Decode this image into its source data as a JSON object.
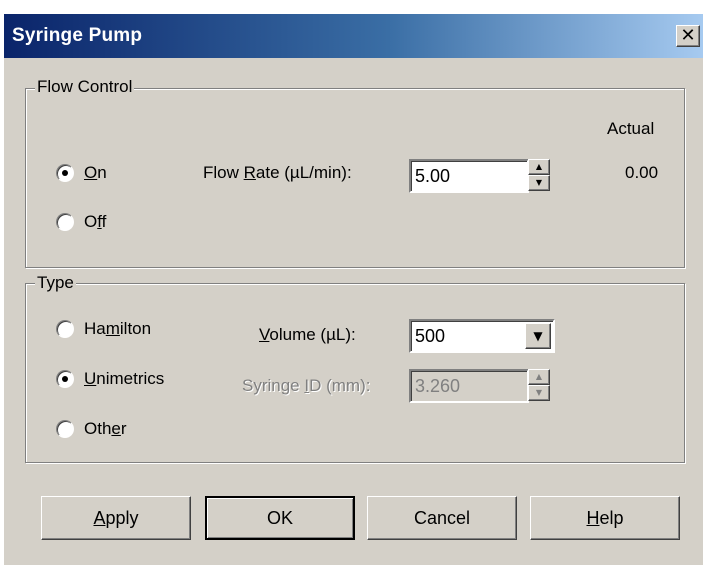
{
  "window": {
    "title": "Syringe Pump",
    "close_glyph": "✕"
  },
  "flow_control": {
    "legend": "Flow Control",
    "actual_header": "Actual",
    "on": {
      "mnemonic": "O",
      "rest": "n",
      "selected": true
    },
    "off": {
      "pre": "O",
      "mnemonic": "f",
      "rest": "f",
      "selected": false
    },
    "flow_rate_label": {
      "pre": "Flow ",
      "mnemonic": "R",
      "rest": "ate (µL/min):"
    },
    "flow_rate_value": "5.00",
    "actual_value": "0.00"
  },
  "type": {
    "legend": "Type",
    "hamilton": {
      "pre": "Ha",
      "mnemonic": "m",
      "rest": "ilton",
      "selected": false
    },
    "unimetrics": {
      "mnemonic": "U",
      "rest": "nimetrics",
      "selected": true
    },
    "other": {
      "pre": "Oth",
      "mnemonic": "e",
      "rest": "r",
      "selected": false
    },
    "volume_label": {
      "mnemonic": "V",
      "rest": "olume (µL):"
    },
    "volume_value": "500",
    "syringe_id_label": {
      "pre": "Syringe ",
      "mnemonic": "I",
      "rest": "D (mm):"
    },
    "syringe_id_value": "3.260"
  },
  "buttons": {
    "apply": {
      "mnemonic": "A",
      "rest": "pply"
    },
    "ok": "OK",
    "cancel": "Cancel",
    "help": {
      "mnemonic": "H",
      "rest": "elp"
    }
  },
  "icons": {
    "spin_up": "▲",
    "spin_down": "▼",
    "dropdown": "▼"
  }
}
